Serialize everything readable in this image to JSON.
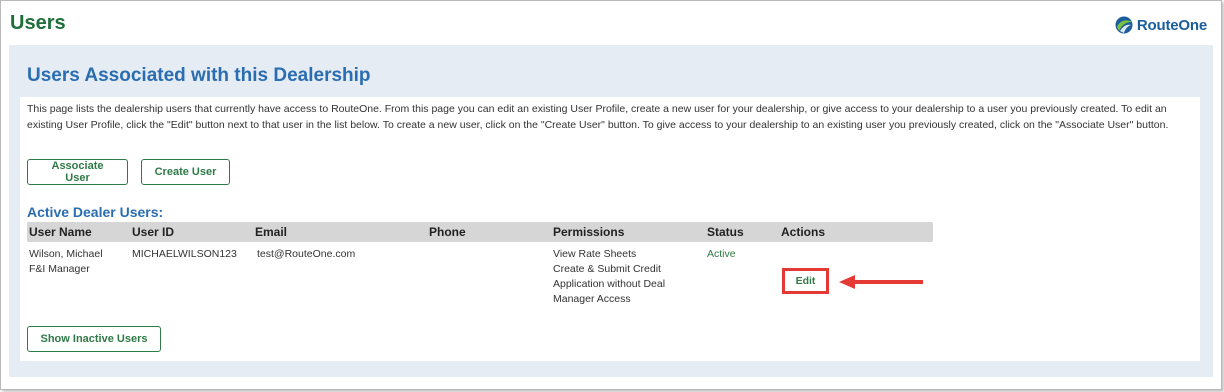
{
  "page": {
    "title": "Users"
  },
  "logo": {
    "text": "RouteOne",
    "icon": "routeone-logo-icon"
  },
  "panel": {
    "title": "Users Associated with this Dealership",
    "intro": "This page lists the dealership users that currently have access to RouteOne. From this page you can edit an existing User Profile, create a new user for your dealership, or give access to your dealership to a user you previously created. To edit an existing User Profile, click the \"Edit\" button next to that user in the list below. To create a new user, click on the \"Create User\" button. To give access to your dealership to an existing user you previously created, click on the \"Associate User\" button.",
    "associate_label": "Associate User",
    "create_label": "Create User",
    "section_title": "Active Dealer Users:",
    "show_inactive_label": "Show Inactive Users"
  },
  "table": {
    "headers": {
      "name": "User Name",
      "user_id": "User ID",
      "email": "Email",
      "phone": "Phone",
      "permissions": "Permissions",
      "status": "Status",
      "actions": "Actions"
    },
    "rows": [
      {
        "name": "Wilson,  Michael",
        "role": "F&I Manager",
        "user_id": "MICHAELWILSON123",
        "email": "test@RouteOne.com",
        "phone": "",
        "permissions": [
          "View Rate Sheets",
          "Create & Submit Credit",
          "Application without Deal",
          "Manager Access"
        ],
        "status": "Active",
        "action_label": "Edit"
      }
    ]
  },
  "colors": {
    "brand_green": "#1f6f3a",
    "accent_blue": "#2a6db0",
    "highlight_red": "#e53935"
  }
}
